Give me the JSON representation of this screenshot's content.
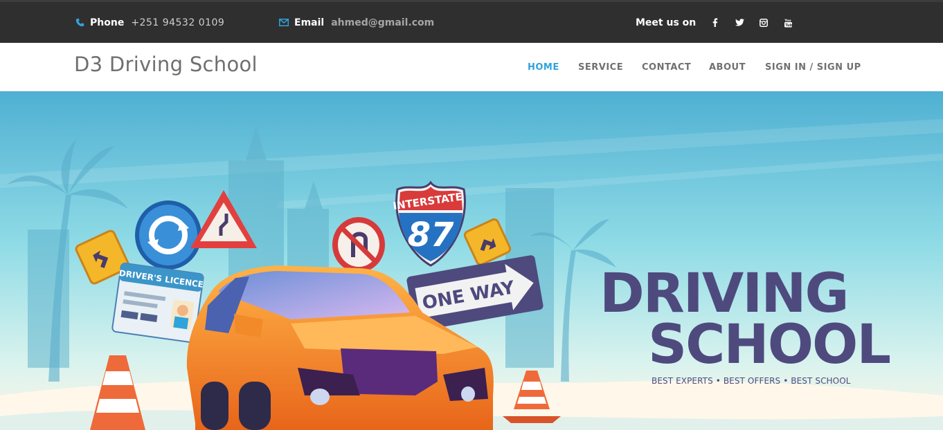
{
  "topbar": {
    "phone_label": "Phone",
    "phone_value": "+251 94532 0109",
    "email_label": "Email",
    "email_value": "ahmed@gmail.com",
    "social_label": "Meet us on",
    "social_icons": [
      "facebook-icon",
      "twitter-icon",
      "instagram-icon",
      "youtube-icon"
    ]
  },
  "nav": {
    "brand": "D3 Driving School",
    "items": [
      "HOME",
      "SERVICE",
      "CONTACT",
      "ABOUT",
      "SIGN IN / SIGN UP"
    ],
    "active_index": 0
  },
  "hero": {
    "title_line1": "DRIVING",
    "title_line2": "SCHOOL",
    "subtitle": "BEST EXPERTS • BEST OFFERS • BEST SCHOOL",
    "licence_text": "DRIVER'S LICENCE",
    "interstate_text": "INTERSTATE",
    "interstate_number": "87",
    "one_way_text": "ONE WAY"
  },
  "colors": {
    "topbar_bg": "#2f2f2f",
    "accent": "#2ea3dc",
    "title": "#4e4a7e",
    "car": "#f07a1e",
    "sky": "#4fb6d6"
  }
}
